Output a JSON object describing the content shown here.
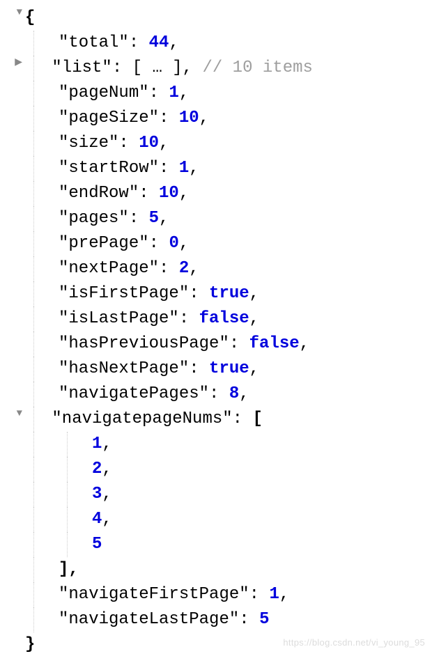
{
  "json": {
    "open_brace": "{",
    "close_brace": "}",
    "open_bracket": "[",
    "close_bracket": "]",
    "close_bracket_comma": "],",
    "collapsed_preview": "[ … ],",
    "comment_list": "// 10 items",
    "entries": {
      "total_key": "\"total\"",
      "total_val": "44",
      "list_key": "\"list\"",
      "pageNum_key": "\"pageNum\"",
      "pageNum_val": "1",
      "pageSize_key": "\"pageSize\"",
      "pageSize_val": "10",
      "size_key": "\"size\"",
      "size_val": "10",
      "startRow_key": "\"startRow\"",
      "startRow_val": "1",
      "endRow_key": "\"endRow\"",
      "endRow_val": "10",
      "pages_key": "\"pages\"",
      "pages_val": "5",
      "prePage_key": "\"prePage\"",
      "prePage_val": "0",
      "nextPage_key": "\"nextPage\"",
      "nextPage_val": "2",
      "isFirstPage_key": "\"isFirstPage\"",
      "isFirstPage_val": "true",
      "isLastPage_key": "\"isLastPage\"",
      "isLastPage_val": "false",
      "hasPreviousPage_key": "\"hasPreviousPage\"",
      "hasPreviousPage_val": "false",
      "hasNextPage_key": "\"hasNextPage\"",
      "hasNextPage_val": "true",
      "navigatePages_key": "\"navigatePages\"",
      "navigatePages_val": "8",
      "navigatepageNums_key": "\"navigatepageNums\"",
      "navigateFirstPage_key": "\"navigateFirstPage\"",
      "navigateFirstPage_val": "1",
      "navigateLastPage_key": "\"navigateLastPage\"",
      "navigateLastPage_val": "5"
    },
    "arr": {
      "v1": "1",
      "v2": "2",
      "v3": "3",
      "v4": "4",
      "v5": "5"
    }
  },
  "watermark": "https://blog.csdn.net/vi_young_95"
}
